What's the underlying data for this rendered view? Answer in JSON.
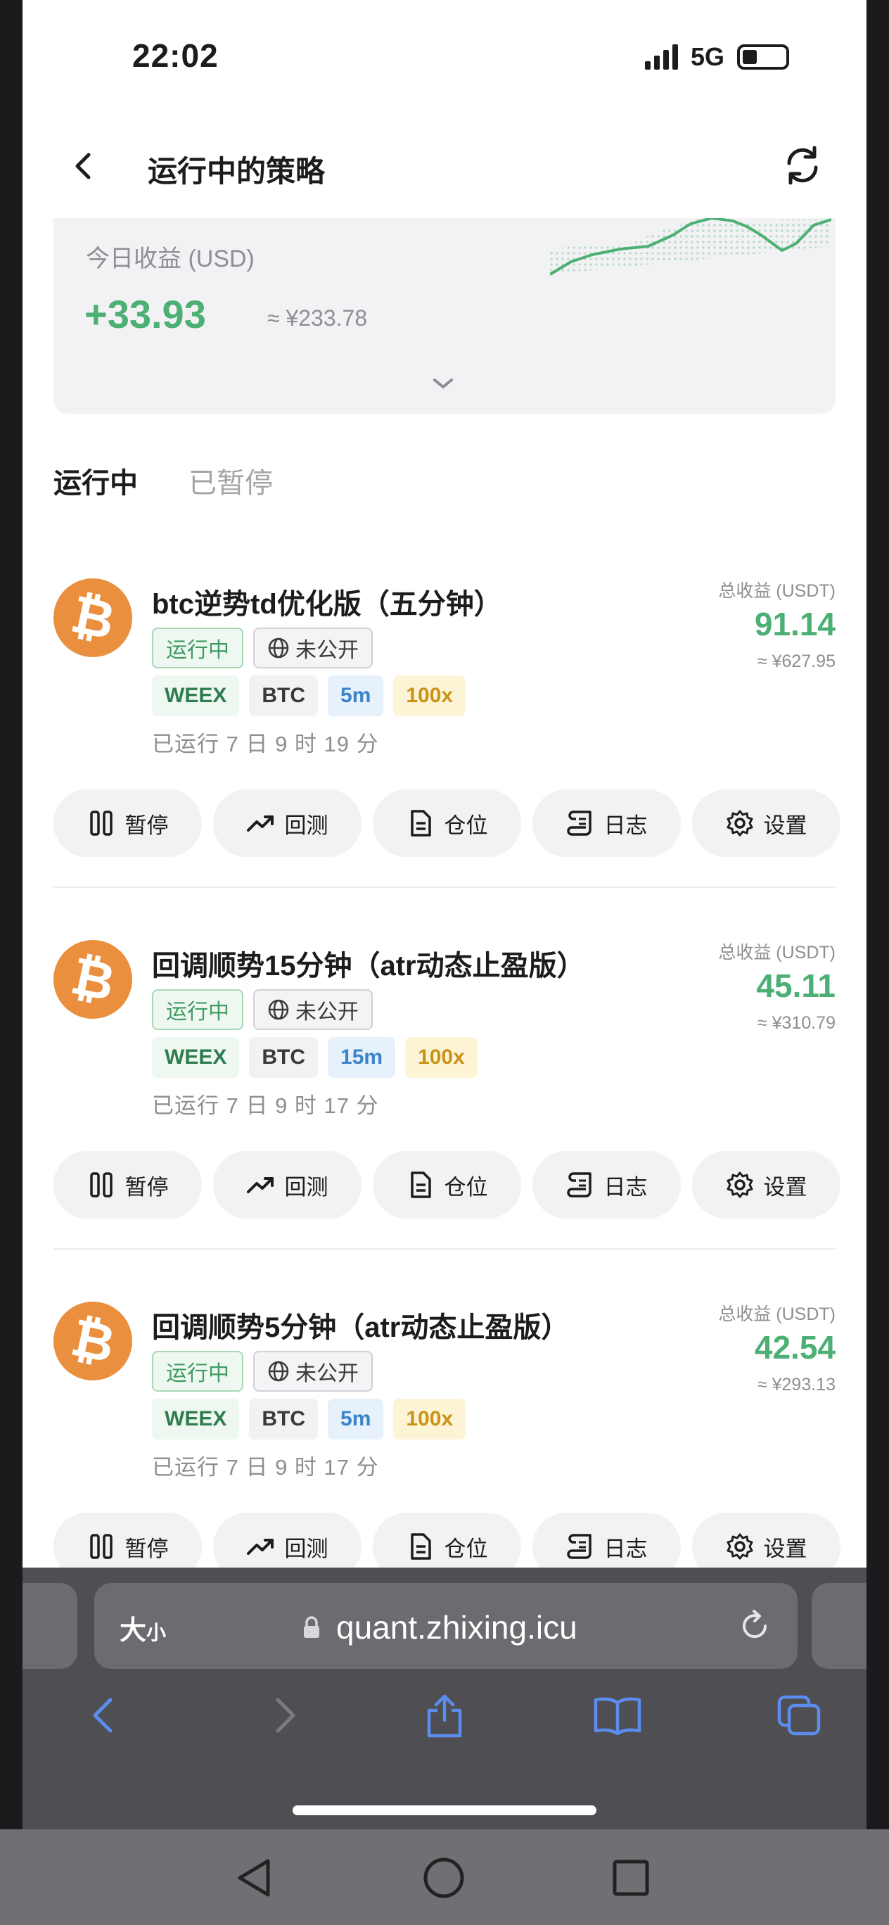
{
  "status_bar": {
    "time": "22:02",
    "network": "5G"
  },
  "header": {
    "title": "运行中的策略"
  },
  "summary": {
    "label": "今日收益 (USD)",
    "value": "+33.93",
    "cny": "≈ ¥233.78"
  },
  "tabs": [
    {
      "label": "运行中",
      "active": true
    },
    {
      "label": "已暂停",
      "active": false
    }
  ],
  "strategies": [
    {
      "name": "btc逆势td优化版（五分钟）",
      "status_tag": "运行中",
      "visibility_tag": "未公开",
      "exchange": "WEEX",
      "symbol": "BTC",
      "timeframe": "5m",
      "leverage": "100x",
      "runtime": "已运行 7 日 9 时 19 分",
      "profit_label": "总收益 (USDT)",
      "profit": "91.14",
      "profit_cny": "≈ ¥627.95"
    },
    {
      "name": "回调顺势15分钟（atr动态止盈版）",
      "status_tag": "运行中",
      "visibility_tag": "未公开",
      "exchange": "WEEX",
      "symbol": "BTC",
      "timeframe": "15m",
      "leverage": "100x",
      "runtime": "已运行 7 日 9 时 17 分",
      "profit_label": "总收益 (USDT)",
      "profit": "45.11",
      "profit_cny": "≈ ¥310.79"
    },
    {
      "name": "回调顺势5分钟（atr动态止盈版）",
      "status_tag": "运行中",
      "visibility_tag": "未公开",
      "exchange": "WEEX",
      "symbol": "BTC",
      "timeframe": "5m",
      "leverage": "100x",
      "runtime": "已运行 7 日 9 时 17 分",
      "profit_label": "总收益 (USDT)",
      "profit": "42.54",
      "profit_cny": "≈ ¥293.13"
    }
  ],
  "actions": {
    "pause": "暂停",
    "backtest": "回测",
    "position": "仓位",
    "log": "日志",
    "settings": "设置"
  },
  "browser": {
    "reader_label": "大",
    "reader_small": "小",
    "url": "quant.zhixing.icu"
  },
  "colors": {
    "profit_green": "#4caf73",
    "coin_orange": "#e98f3e",
    "timeframe_blue": "#3b84c9",
    "leverage_gold": "#c99316"
  }
}
